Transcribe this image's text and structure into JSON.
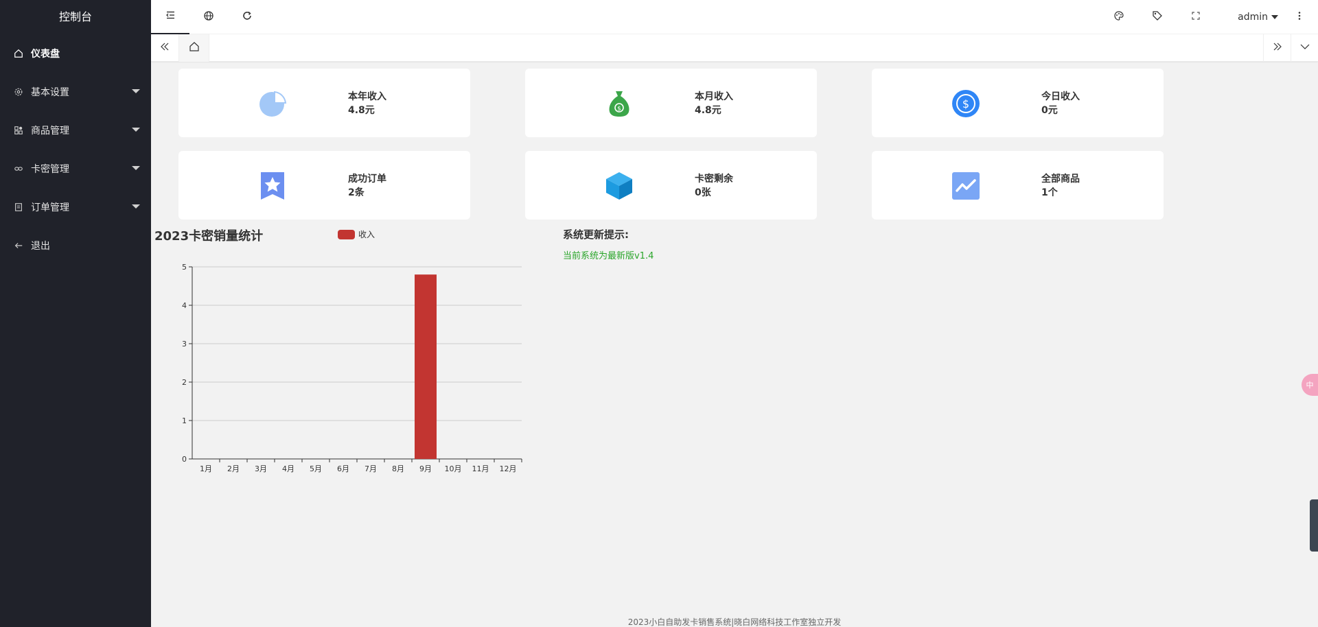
{
  "sidebar": {
    "title": "控制台",
    "items": [
      {
        "label": "仪表盘",
        "icon": "home-icon"
      },
      {
        "label": "基本设置",
        "icon": "settings-icon"
      },
      {
        "label": "商品管理",
        "icon": "apps-icon"
      },
      {
        "label": "卡密管理",
        "icon": "link-icon"
      },
      {
        "label": "订单管理",
        "icon": "order-icon"
      },
      {
        "label": "退出",
        "icon": "arrow-left-icon"
      }
    ]
  },
  "header": {
    "user": "admin",
    "icons": [
      "shrink-menu-icon",
      "globe-icon",
      "refresh-icon",
      "theme-palette-icon",
      "tag-icon",
      "fullscreen-icon",
      "more-vertical-icon"
    ]
  },
  "cards": [
    {
      "label": "本年收入",
      "value": "4.8元",
      "icon": "pie-chart-icon",
      "color": "#a3c8f7"
    },
    {
      "label": "本月收入",
      "value": "4.8元",
      "icon": "money-bag-icon",
      "color": "#3ca64a"
    },
    {
      "label": "今日收入",
      "value": "0元",
      "icon": "dollar-coin-icon",
      "color": "#2f86f6"
    },
    {
      "label": "成功订单",
      "value": "2条",
      "icon": "star-badge-icon",
      "color": "#6c8ff0"
    },
    {
      "label": "卡密剩余",
      "value": "0张",
      "icon": "cube-icon",
      "color": "#1d9be0"
    },
    {
      "label": "全部商品",
      "value": "1个",
      "icon": "trend-chart-icon",
      "color": "#7aa6f5"
    }
  ],
  "chart_data": {
    "type": "bar",
    "title": "2023卡密销量统计",
    "categories": [
      "1月",
      "2月",
      "3月",
      "4月",
      "5月",
      "6月",
      "7月",
      "8月",
      "9月",
      "10月",
      "11月",
      "12月"
    ],
    "series": [
      {
        "name": "收入",
        "values": [
          0,
          0,
          0,
          0,
          0,
          0,
          0,
          0,
          4.8,
          0,
          0,
          0
        ],
        "color": "#c23531"
      }
    ],
    "yticks": [
      "0",
      "1",
      "2",
      "3",
      "4",
      "5"
    ],
    "ylim": [
      0,
      5
    ],
    "grid": true,
    "legend": "top"
  },
  "update": {
    "title": "系统更新提示:",
    "text": "当前系统为最新版v1.4"
  },
  "footer": "2023小白自助发卡销售系统|晓白网络科技工作室独立开发",
  "float_badge": "中"
}
